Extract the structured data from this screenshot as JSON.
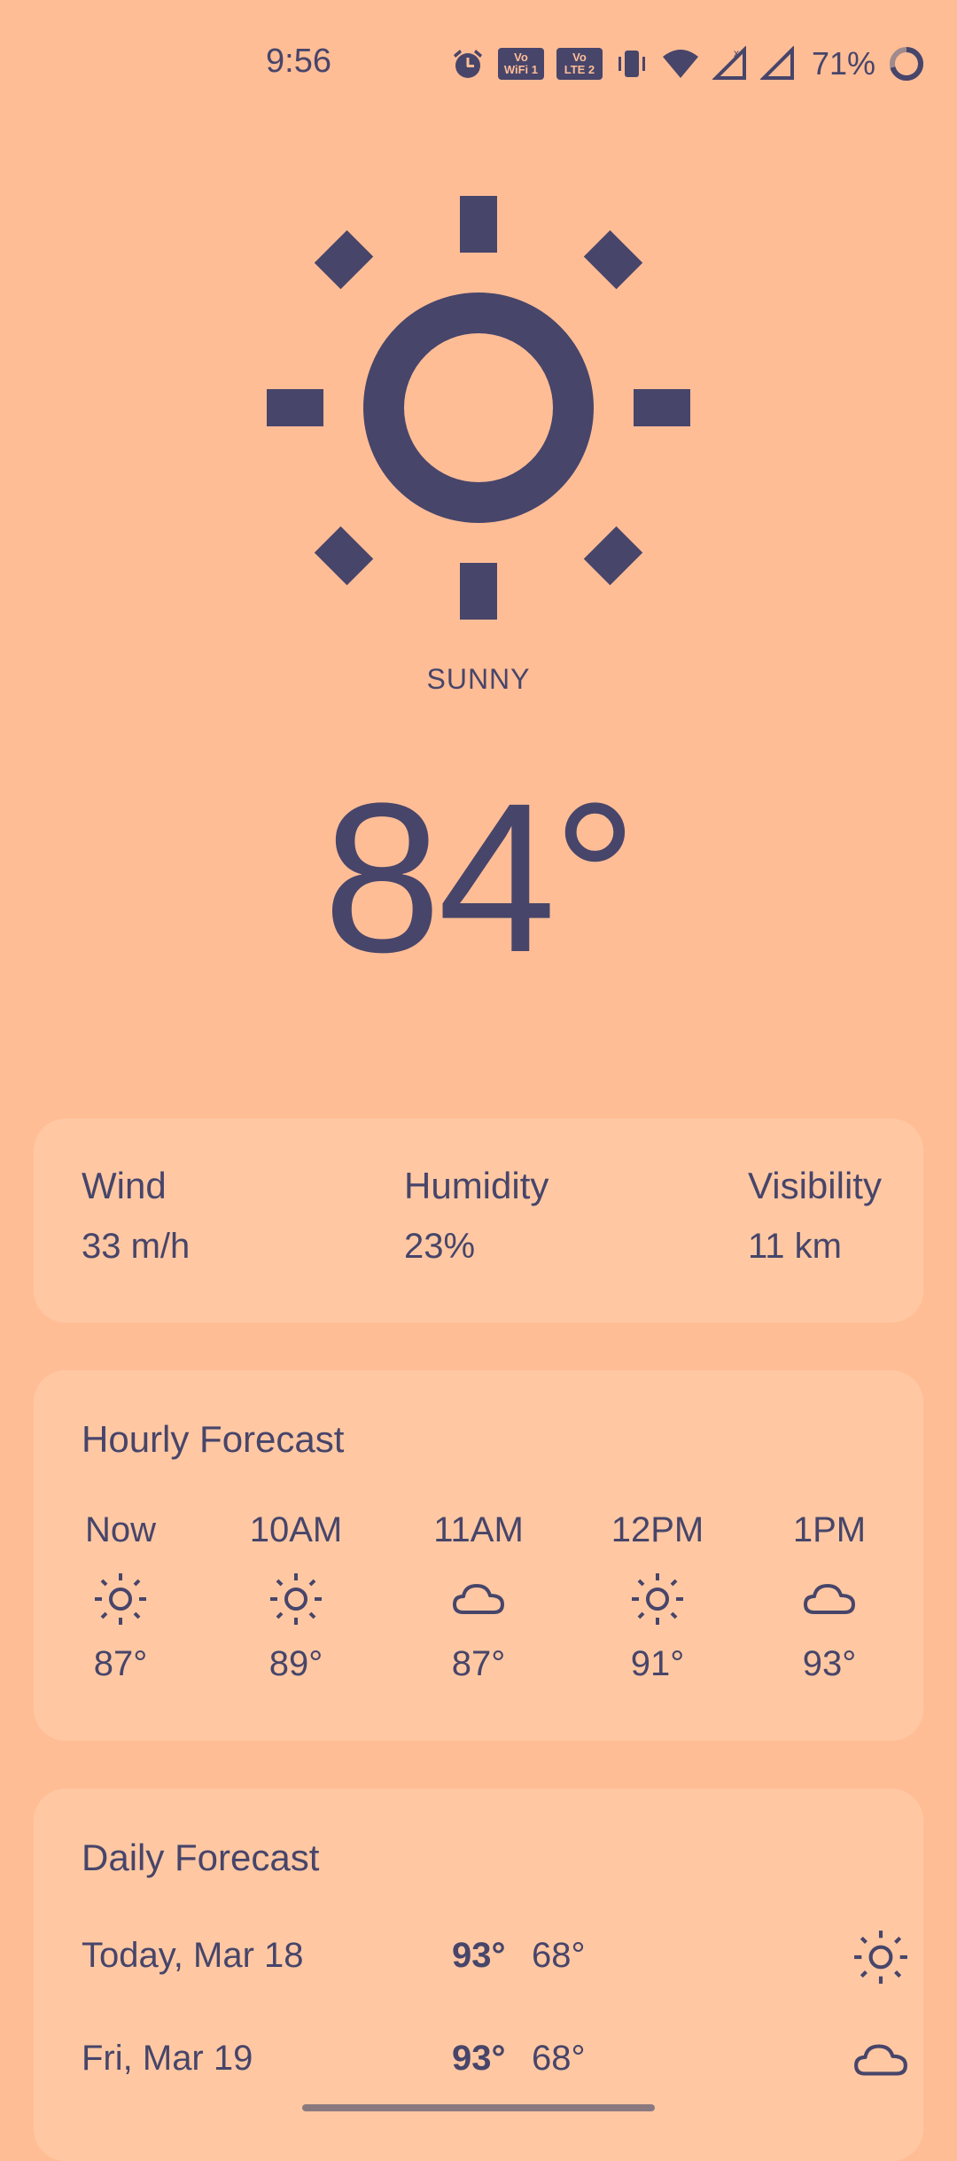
{
  "status_bar": {
    "time": "9:56",
    "tag_wifi_top": "Vo",
    "tag_wifi_bottom": "WiFi 1",
    "tag_lte_top": "Vo",
    "tag_lte_bottom": "LTE 2",
    "battery": "71%",
    "icons": [
      "alarm-icon",
      "vowifi-icon",
      "volte-icon",
      "vibrate-icon",
      "wifi-icon",
      "signal-icon",
      "signal-icon",
      "battery-icon"
    ]
  },
  "current": {
    "condition": "SUNNY",
    "temperature": "84°",
    "icon": "sun-icon"
  },
  "stats": [
    {
      "label": "Wind",
      "value": "33 m/h"
    },
    {
      "label": "Humidity",
      "value": "23%"
    },
    {
      "label": "Visibility",
      "value": "11 km"
    }
  ],
  "hourly": {
    "title": "Hourly Forecast",
    "items": [
      {
        "time": "Now",
        "icon": "sun-icon",
        "temp": "87°"
      },
      {
        "time": "10AM",
        "icon": "sun-icon",
        "temp": "89°"
      },
      {
        "time": "11AM",
        "icon": "cloud-icon",
        "temp": "87°"
      },
      {
        "time": "12PM",
        "icon": "sun-icon",
        "temp": "91°"
      },
      {
        "time": "1PM",
        "icon": "cloud-icon",
        "temp": "93°"
      }
    ]
  },
  "daily": {
    "title": "Daily Forecast",
    "items": [
      {
        "day": "Today, Mar 18",
        "high": "93°",
        "low": "68°",
        "icon": "sun-icon"
      },
      {
        "day": "Fri, Mar 19",
        "high": "93°",
        "low": "68°",
        "icon": "cloud-icon"
      }
    ]
  },
  "colors": {
    "background": "#FFBD96",
    "card": "#FFC8A3",
    "foreground": "#47456A"
  }
}
